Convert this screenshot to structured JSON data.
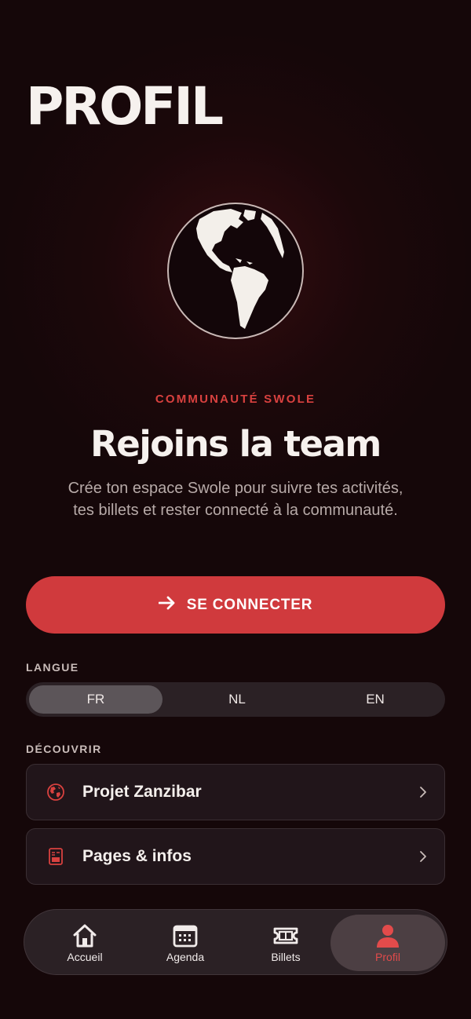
{
  "page": {
    "title": "PROFIL"
  },
  "hero": {
    "eyebrow": "COMMUNAUTÉ SWOLE",
    "headline": "Rejoins la team",
    "description": "Crée ton espace Swole pour suivre tes activités, tes billets et rester connecté à la communauté.",
    "cta_label": "SE CONNECTER",
    "cta_icon": "arrow-right-icon",
    "image_icon": "globe-icon"
  },
  "language": {
    "label": "LANGUE",
    "options": [
      "FR",
      "NL",
      "EN"
    ],
    "selected": "FR"
  },
  "discover": {
    "label": "DÉCOUVRIR",
    "items": [
      {
        "label": "Projet Zanzibar",
        "icon": "globe-outline-icon"
      },
      {
        "label": "Pages & infos",
        "icon": "document-icon"
      }
    ]
  },
  "tabbar": {
    "items": [
      {
        "label": "Accueil",
        "icon": "home-icon"
      },
      {
        "label": "Agenda",
        "icon": "calendar-icon"
      },
      {
        "label": "Billets",
        "icon": "ticket-icon"
      },
      {
        "label": "Profil",
        "icon": "user-icon"
      }
    ],
    "active": "Profil"
  },
  "colors": {
    "background": "#150709",
    "accent": "#d03a3d",
    "text": "#f4efec",
    "muted": "#b7aaa8"
  }
}
